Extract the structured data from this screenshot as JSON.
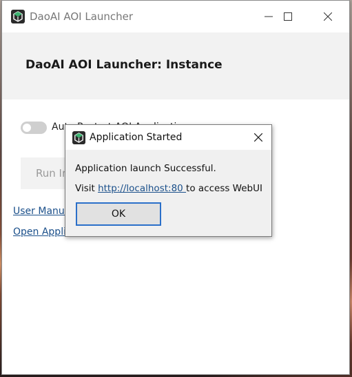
{
  "window": {
    "title": "DaoAI AOI Launcher"
  },
  "header": {
    "title": "DaoAI AOI Launcher: Instance"
  },
  "settings": {
    "auto_restart_label": "Auto Restart AOI Application",
    "auto_restart_enabled": false
  },
  "actions": {
    "run_button_label": "Run Instance"
  },
  "links": {
    "user_manual": "User Manual",
    "open_app": "Open Application Folder"
  },
  "dialog": {
    "title": "Application Started",
    "message": "Application launch Successful.",
    "visit_prefix": "Visit ",
    "url": "http://localhost:80 ",
    "visit_suffix": "to access WebUI",
    "ok_label": "OK"
  },
  "colors": {
    "accent": "#2a6fc9",
    "link": "#1a4f8a",
    "icon_green": "#3cb371"
  },
  "icons": {
    "app": "app-cube-icon",
    "minimize": "minimize-icon",
    "maximize": "maximize-icon",
    "close": "close-icon"
  }
}
